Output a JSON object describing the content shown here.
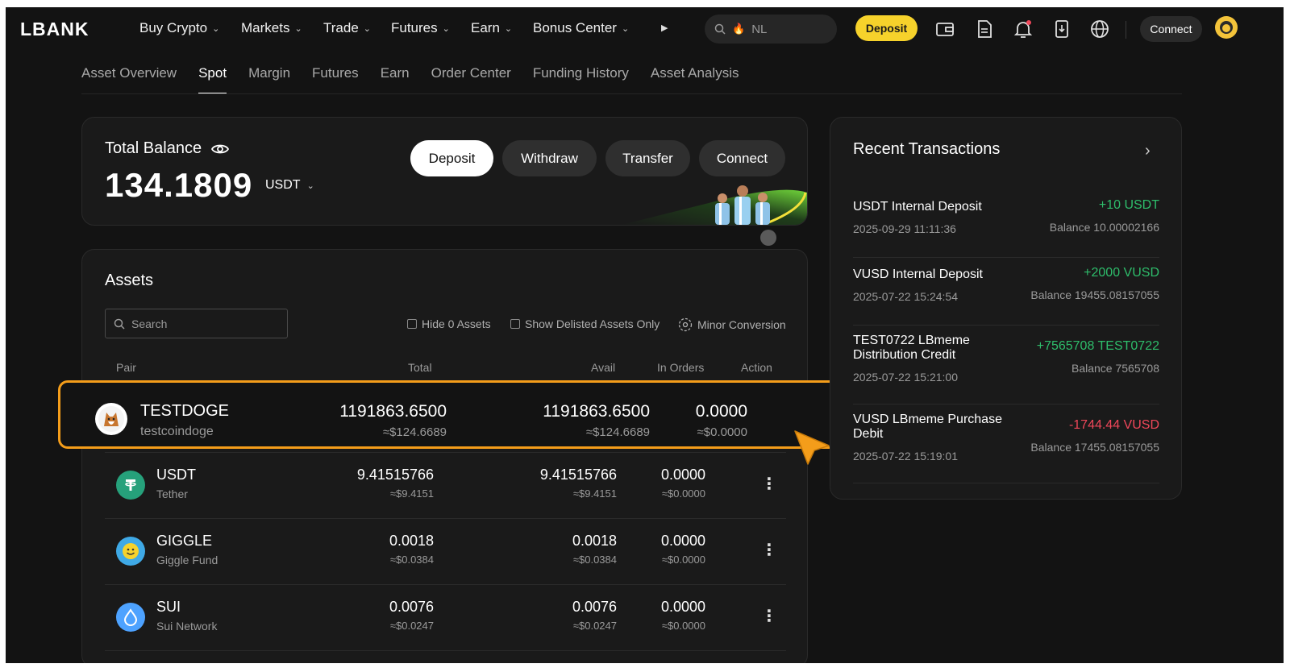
{
  "nav": {
    "logo": "LBANK",
    "items": [
      "Buy Crypto",
      "Markets",
      "Trade",
      "Futures",
      "Earn",
      "Bonus Center"
    ],
    "search_value": "NL",
    "deposit_label": "Deposit",
    "connect_label": "Connect"
  },
  "subtabs": [
    "Asset Overview",
    "Spot",
    "Margin",
    "Futures",
    "Earn",
    "Order Center",
    "Funding History",
    "Asset Analysis"
  ],
  "balance": {
    "label": "Total Balance",
    "value": "134.1809",
    "unit": "USDT",
    "buttons": [
      "Deposit",
      "Withdraw",
      "Transfer",
      "Connect"
    ]
  },
  "assets": {
    "title": "Assets",
    "search_placeholder": "Search",
    "filters": [
      "Hide 0 Assets",
      "Show Delisted Assets Only",
      "Minor Conversion"
    ],
    "columns": [
      "Pair",
      "Total",
      "Avail",
      "In Orders",
      "Action"
    ],
    "rows": [
      {
        "symbol": "TESTDOGE",
        "name": "testcoindoge",
        "total": "1191863.6500",
        "total_usd": "≈$124.6689",
        "avail": "1191863.6500",
        "avail_usd": "≈$124.6689",
        "orders": "0.0000",
        "orders_usd": "≈$0.0000"
      },
      {
        "symbol": "USDT",
        "name": "Tether",
        "total": "9.41515766",
        "total_usd": "≈$9.4151",
        "avail": "9.41515766",
        "avail_usd": "≈$9.4151",
        "orders": "0.0000",
        "orders_usd": "≈$0.0000"
      },
      {
        "symbol": "GIGGLE",
        "name": "Giggle Fund",
        "total": "0.0018",
        "total_usd": "≈$0.0384",
        "avail": "0.0018",
        "avail_usd": "≈$0.0384",
        "orders": "0.0000",
        "orders_usd": "≈$0.0000"
      },
      {
        "symbol": "SUI",
        "name": "Sui Network",
        "total": "0.0076",
        "total_usd": "≈$0.0247",
        "avail": "0.0076",
        "avail_usd": "≈$0.0247",
        "orders": "0.0000",
        "orders_usd": "≈$0.0000"
      }
    ]
  },
  "transactions": {
    "title": "Recent Transactions",
    "items": [
      {
        "name": "USDT Internal Deposit",
        "date": "2025-09-29 11:11:36",
        "amount": "+10 USDT",
        "balance": "Balance 10.00002166"
      },
      {
        "name": "VUSD Internal Deposit",
        "date": "2025-07-22 15:24:54",
        "amount": "+2000 VUSD",
        "balance": "Balance 19455.08157055"
      },
      {
        "name": "TEST0722 LBmeme Distribution Credit",
        "date": "2025-07-22 15:21:00",
        "amount": "+7565708 TEST0722",
        "balance": "Balance 7565708"
      },
      {
        "name": "VUSD LBmeme Purchase Debit",
        "date": "2025-07-22 15:19:01",
        "amount": "-1744.44 VUSD",
        "balance": "Balance 17455.08157055"
      }
    ]
  },
  "colors": {
    "background": "#131313",
    "card": "#1a1a1a",
    "accent_yellow": "#f6d22b",
    "highlight_orange": "#f49d1a",
    "positive": "#2ebd6b",
    "negative": "#f0475a"
  },
  "icons": [
    "search-icon",
    "flame-icon",
    "wallet-icon",
    "document-icon",
    "bell-icon",
    "download-icon",
    "globe-icon",
    "eye-icon",
    "chevron-down-icon",
    "chevron-right-icon",
    "kebab-menu-icon",
    "conversion-icon",
    "cursor-pointer-icon"
  ]
}
